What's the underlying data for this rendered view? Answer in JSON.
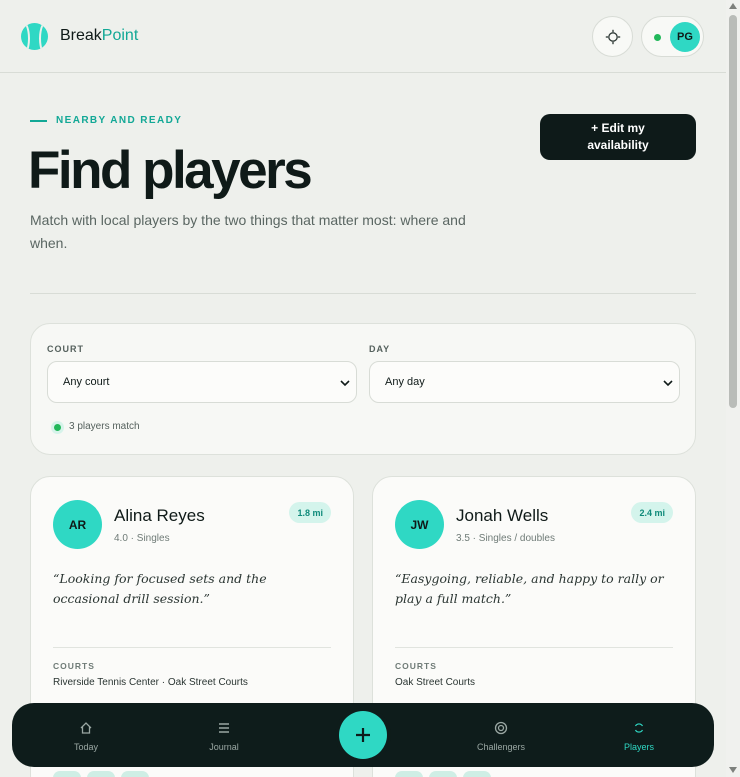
{
  "app": {
    "brand_prefix": "Break",
    "brand_suffix": "Point"
  },
  "header": {
    "settings_icon": "sun-settings-icon",
    "profile": {
      "initials": "PG",
      "status": "online"
    }
  },
  "hero": {
    "eyebrow": "NEARBY AND READY",
    "title": "Find players",
    "subtitle": "Match with local players by the two things that matter most: where and when.",
    "edit_button": "+ Edit my availability"
  },
  "filters": {
    "court": {
      "label": "COURT",
      "value": "Any court"
    },
    "day": {
      "label": "DAY",
      "value": "Any day"
    },
    "match_count": "3 players match"
  },
  "players": [
    {
      "initials": "AR",
      "name": "Alina Reyes",
      "meta": "4.0 · Singles",
      "distance": "1.8 mi",
      "quote": "“Looking for focused sets and the occasional drill session.”",
      "courts_label": "COURTS",
      "courts": "Riverside Tennis Center · Oak Street Courts"
    },
    {
      "initials": "JW",
      "name": "Jonah Wells",
      "meta": "3.5 · Singles / doubles",
      "distance": "2.4 mi",
      "quote": "“Easygoing, reliable, and happy to rally or play a full match.”",
      "courts_label": "COURTS",
      "courts": "Oak Street Courts"
    }
  ],
  "nav": {
    "items": [
      {
        "label": "Today",
        "icon": "home-icon"
      },
      {
        "label": "Journal",
        "icon": "list-icon"
      },
      {
        "label": "Challengers",
        "icon": "target-icon"
      },
      {
        "label": "Players",
        "icon": "players-icon"
      }
    ],
    "active": "Players",
    "fab_icon": "plus-icon"
  },
  "colors": {
    "accent": "#2fd8c4",
    "accent_dark": "#12a896",
    "dark": "#0e1c1b",
    "status_green": "#22b85a"
  }
}
